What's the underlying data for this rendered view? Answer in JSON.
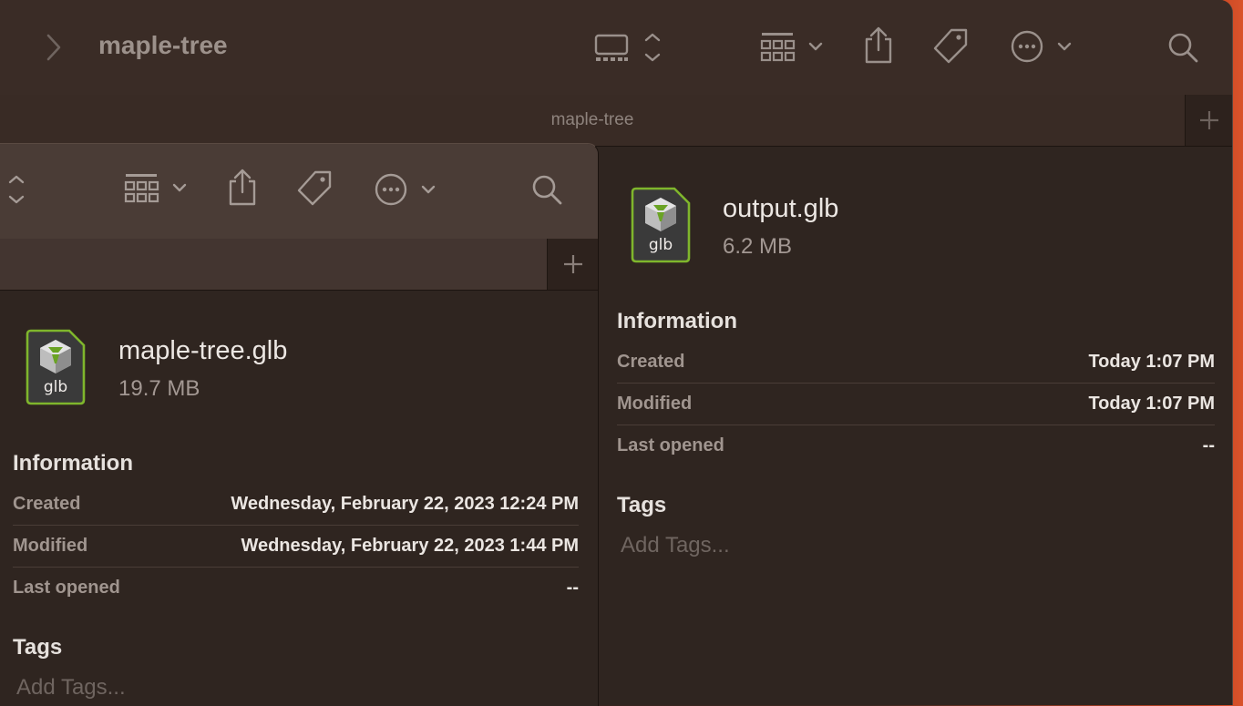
{
  "back_window": {
    "title": "maple-tree",
    "tab_label": "maple-tree",
    "toolbar_icons": [
      "chevron-right-icon",
      "view-mode-icon",
      "group-icon",
      "share-icon",
      "tag-icon",
      "more-icon",
      "search-icon"
    ]
  },
  "right_pane": {
    "file_name": "output.glb",
    "file_size": "6.2 MB",
    "icon_ext": "glb",
    "info_heading": "Information",
    "created_label": "Created",
    "created_value": "Today 1:07 PM",
    "modified_label": "Modified",
    "modified_value": "Today 1:07 PM",
    "last_opened_label": "Last opened",
    "last_opened_value": "--",
    "tags_heading": "Tags",
    "tags_placeholder": "Add Tags..."
  },
  "front_window": {
    "file_name": "maple-tree.glb",
    "file_size": "19.7 MB",
    "icon_ext": "glb",
    "info_heading": "Information",
    "created_label": "Created",
    "created_value": "Wednesday, February 22, 2023 12:24 PM",
    "modified_label": "Modified",
    "modified_value": "Wednesday, February 22, 2023 1:44 PM",
    "last_opened_label": "Last opened",
    "last_opened_value": "--",
    "tags_heading": "Tags",
    "tags_placeholder": "Add Tags..."
  },
  "colors": {
    "accent_green": "#7fb62c",
    "desktop_orange": "#d9532b"
  }
}
